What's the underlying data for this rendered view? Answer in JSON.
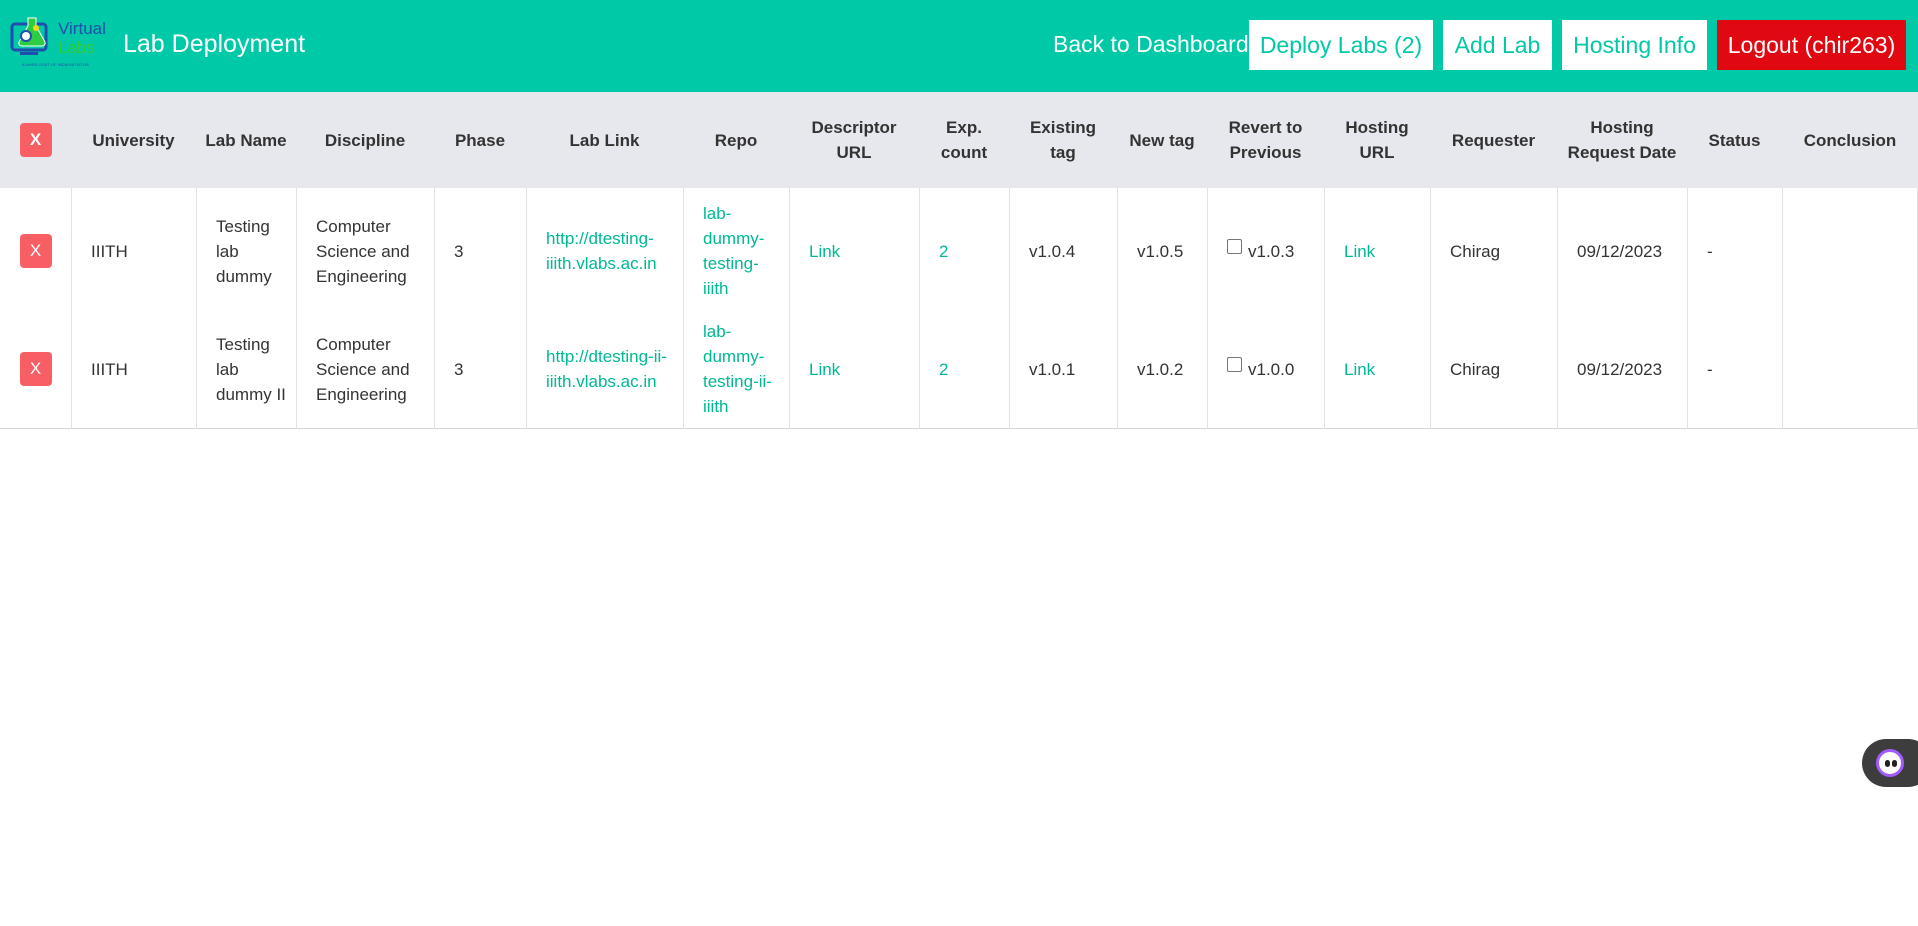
{
  "navbar": {
    "logo": {
      "word1": "Virtual",
      "word2": "Labs",
      "tagline": "A MHRD GOVT OF INDIA INITIATIVE"
    },
    "title": "Lab Deployment",
    "back_link": "Back to Dashboard",
    "deploy_button": "Deploy Labs (2)",
    "add_button": "Add Lab",
    "hosting_button": "Hosting Info",
    "logout_button": "Logout (chir263)",
    "colors": {
      "primary": "#00c9a7",
      "logout": "#e00912"
    }
  },
  "table": {
    "clear_all_label": "X",
    "headers": [
      "University",
      "Lab Name",
      "Discipline",
      "Phase",
      "Lab Link",
      "Repo",
      "Descriptor URL",
      "Exp. count",
      "Existing tag",
      "New tag",
      "Revert to Previous",
      "Hosting URL",
      "Requester",
      "Hosting Request Date",
      "Status",
      "Conclusion"
    ],
    "rows": [
      {
        "remove_label": "X",
        "university": "IIITH",
        "lab_name": "Testing lab dummy",
        "discipline": "Computer Science and Engineering",
        "phase": "3",
        "lab_link": "http://dtesting-iiith.vlabs.ac.in",
        "repo": "lab-dummy-testing-iiith",
        "descriptor_url": "Link",
        "exp_count": "2",
        "existing_tag": "v1.0.4",
        "new_tag": "v1.0.5",
        "revert_checked": false,
        "revert_tag": "v1.0.3",
        "hosting_url": "Link",
        "requester": "Chirag",
        "request_date": "09/12/2023",
        "status": "-",
        "conclusion": ""
      },
      {
        "remove_label": "X",
        "university": "IIITH",
        "lab_name": "Testing lab dummy II",
        "discipline": "Computer Science and Engineering",
        "phase": "3",
        "lab_link": "http://dtesting-ii-iiith.vlabs.ac.in",
        "repo": "lab-dummy-testing-ii-iiith",
        "descriptor_url": "Link",
        "exp_count": "2",
        "existing_tag": "v1.0.1",
        "new_tag": "v1.0.2",
        "revert_checked": false,
        "revert_tag": "v1.0.0",
        "hosting_url": "Link",
        "requester": "Chirag",
        "request_date": "09/12/2023",
        "status": "-",
        "conclusion": ""
      }
    ]
  },
  "chat_widget": {
    "icon": "chat-bot-icon"
  }
}
